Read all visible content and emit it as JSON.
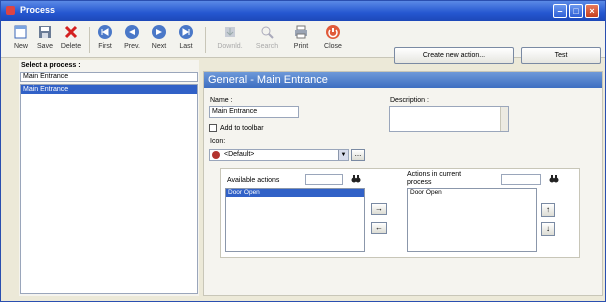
{
  "window": {
    "title": "Process"
  },
  "toolbar": {
    "new": "New",
    "save": "Save",
    "delete": "Delete",
    "first": "First",
    "prev": "Prev.",
    "next": "Next",
    "last": "Last",
    "download": "Downld.",
    "search": "Search",
    "print": "Print",
    "close": "Close"
  },
  "actions": {
    "create_new": "Create new action...",
    "test": "Test"
  },
  "left": {
    "label": "Select a process :",
    "current_value": "Main Entrance",
    "items": [
      "Main Entrance"
    ]
  },
  "general": {
    "header": "General - Main Entrance",
    "name_label": "Name :",
    "name_value": "Main Entrance",
    "description_label": "Description :",
    "add_to_toolbar": "Add to toolbar",
    "icon_label": "Icon:",
    "icon_value": "<Default>",
    "ellipsis": "...",
    "available_actions_label": "Available actions",
    "available_actions": [
      "Door Open"
    ],
    "current_actions_label": "Actions in current process",
    "current_actions": [
      "Door Open"
    ]
  }
}
